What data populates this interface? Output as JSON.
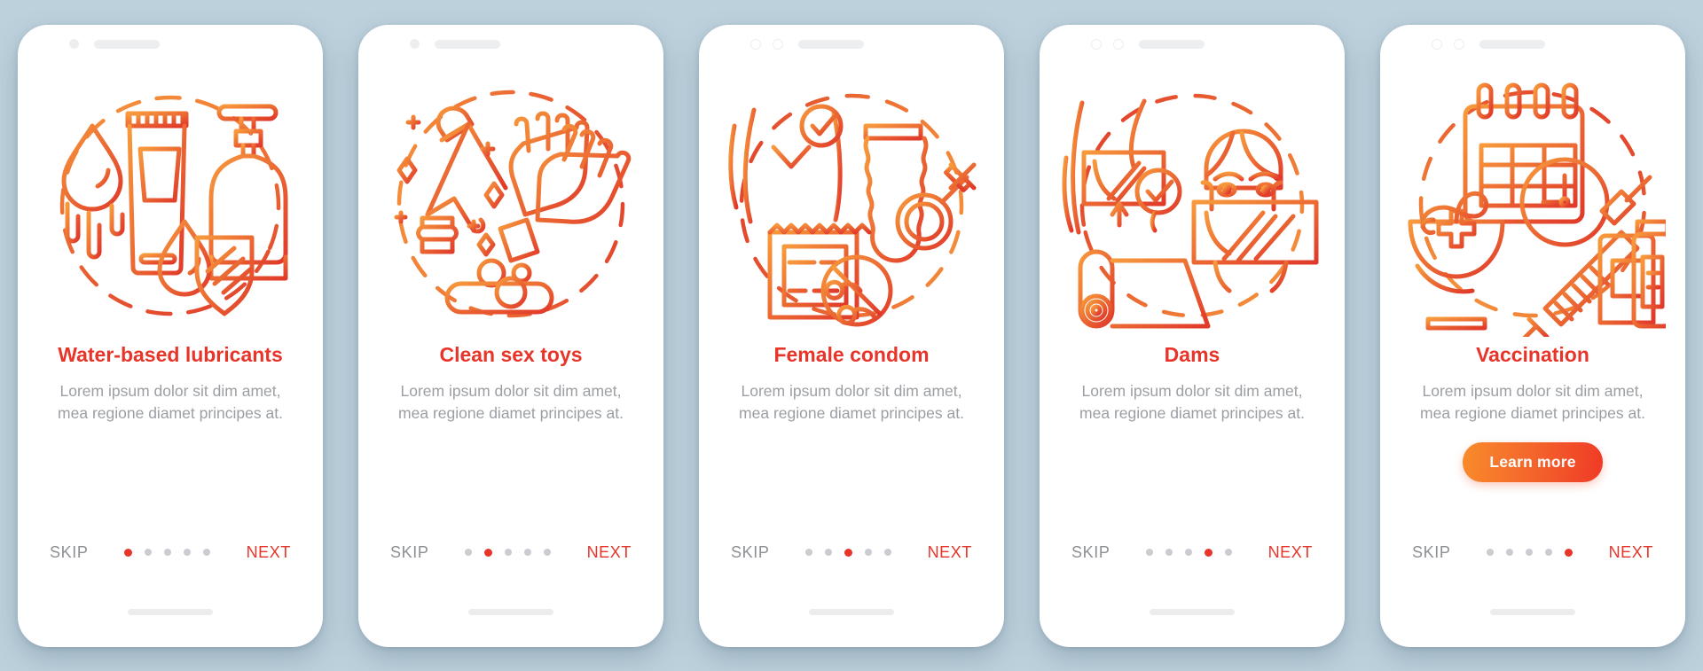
{
  "background_color": "#bdd1dc",
  "accent_color": "#e8352a",
  "muted_text_color": "#9b9fa3",
  "screens": [
    {
      "title": "Water-based lubricants",
      "description": "Lorem ipsum dolor sit dim amet, mea regione diamet principes at.",
      "skip_label": "SKIP",
      "next_label": "NEXT",
      "active_dot": 1,
      "dot_count": 5,
      "illustration": "lubricant-bottles-drop-shield",
      "has_learn_more": false,
      "learn_more_label": "",
      "notch_style": "dot-and-speaker"
    },
    {
      "title": "Clean sex toys",
      "description": "Lorem ipsum dolor sit dim amet, mea regione diamet principes at.",
      "skip_label": "SKIP",
      "next_label": "NEXT",
      "active_dot": 2,
      "dot_count": 5,
      "illustration": "sex-toy-gloves-soap-sparkles",
      "has_learn_more": false,
      "learn_more_label": "",
      "notch_style": "dot-and-speaker"
    },
    {
      "title": "Female condom",
      "description": "Lorem ipsum dolor sit dim amet, mea regione diamet principes at.",
      "skip_label": "SKIP",
      "next_label": "NEXT",
      "active_dot": 3,
      "dot_count": 5,
      "illustration": "female-condom-package-no-sperm",
      "has_learn_more": false,
      "learn_more_label": "",
      "notch_style": "two-rings-and-speaker"
    },
    {
      "title": "Dams",
      "description": "Lorem ipsum dolor sit dim amet, mea regione diamet principes at.",
      "skip_label": "SKIP",
      "next_label": "NEXT",
      "active_dot": 4,
      "dot_count": 5,
      "illustration": "dental-dam-woman-roll-check",
      "has_learn_more": false,
      "learn_more_label": "",
      "notch_style": "two-rings-and-speaker"
    },
    {
      "title": "Vaccination",
      "description": "Lorem ipsum dolor sit dim amet, mea regione diamet principes at.",
      "skip_label": "SKIP",
      "next_label": "NEXT",
      "active_dot": 5,
      "dot_count": 5,
      "illustration": "calendar-clock-pharmacy-syringe-vials",
      "has_learn_more": true,
      "learn_more_label": "Learn more",
      "notch_style": "two-rings-and-speaker"
    }
  ]
}
